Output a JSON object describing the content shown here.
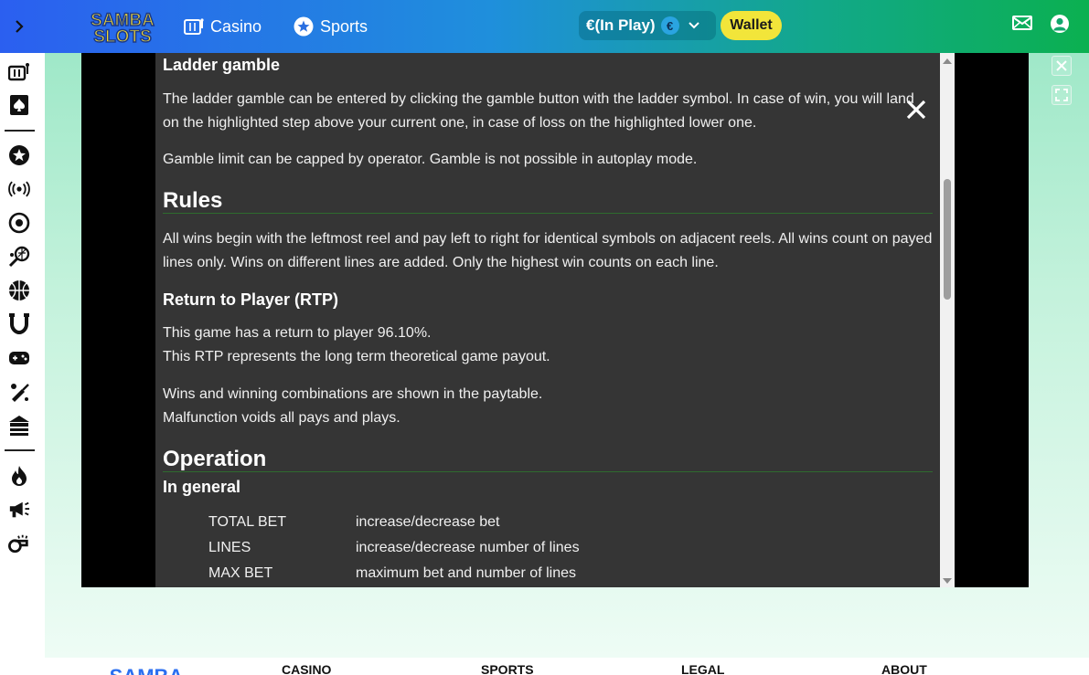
{
  "header": {
    "expand_icon": "chevron-right-icon",
    "logo_text_line1": "SAMBA",
    "logo_text_line2": "SLOTS",
    "nav_casino": "Casino",
    "nav_sports": "Sports",
    "balance": "€(In Play)",
    "currency_symbol": "€",
    "wallet": "Wallet",
    "colors": {
      "wallet_bg": "#f2e53a",
      "logo_yellow": "#f7dc2f"
    }
  },
  "sidebar": {
    "icons": [
      "casino-icon",
      "cards-icon",
      "star-icon",
      "live-icon",
      "football-icon",
      "tennis-icon",
      "basketball-icon",
      "horseshoe-icon",
      "gamepad-icon",
      "cricket-icon",
      "table-games-icon",
      "fire-icon",
      "megaphone-icon",
      "whistle-icon"
    ]
  },
  "rules": {
    "ladder_title": "Ladder gamble",
    "ladder_p1": "The ladder gamble can be entered by clicking the gamble button with the ladder symbol. In case of win, you will land on the highlighted step above your current one, in case of loss on the highlighted lower one.",
    "ladder_p2": "Gamble limit can be capped by operator. Gamble is not possible in autoplay mode.",
    "rules_title": "Rules",
    "rules_p1": "All wins begin with the leftmost reel and pay left to right for identical symbols on adjacent reels. All wins count on payed lines only. Wins on different lines are added. Only the highest win counts on each line.",
    "rtp_title": "Return to Player (RTP)",
    "rtp_l1": "This game has a return to player 96.10%.",
    "rtp_l2": "This RTP represents the long term theoretical game payout.",
    "wins_l1": "Wins and winning combinations are shown in the paytable.",
    "wins_l2": "Malfunction voids all pays and plays.",
    "operation_title": "Operation",
    "general_title": "In general",
    "operation_rows": [
      {
        "key": "TOTAL BET",
        "value": "increase/decrease bet"
      },
      {
        "key": "LINES",
        "value": "increase/decrease number of lines"
      },
      {
        "key": "MAX BET",
        "value": "maximum bet and number of lines"
      }
    ]
  },
  "footer": {
    "logo_text": "SAMBA",
    "casino": "CASINO",
    "sports": "SPORTS",
    "legal": "LEGAL",
    "about": "ABOUT"
  }
}
